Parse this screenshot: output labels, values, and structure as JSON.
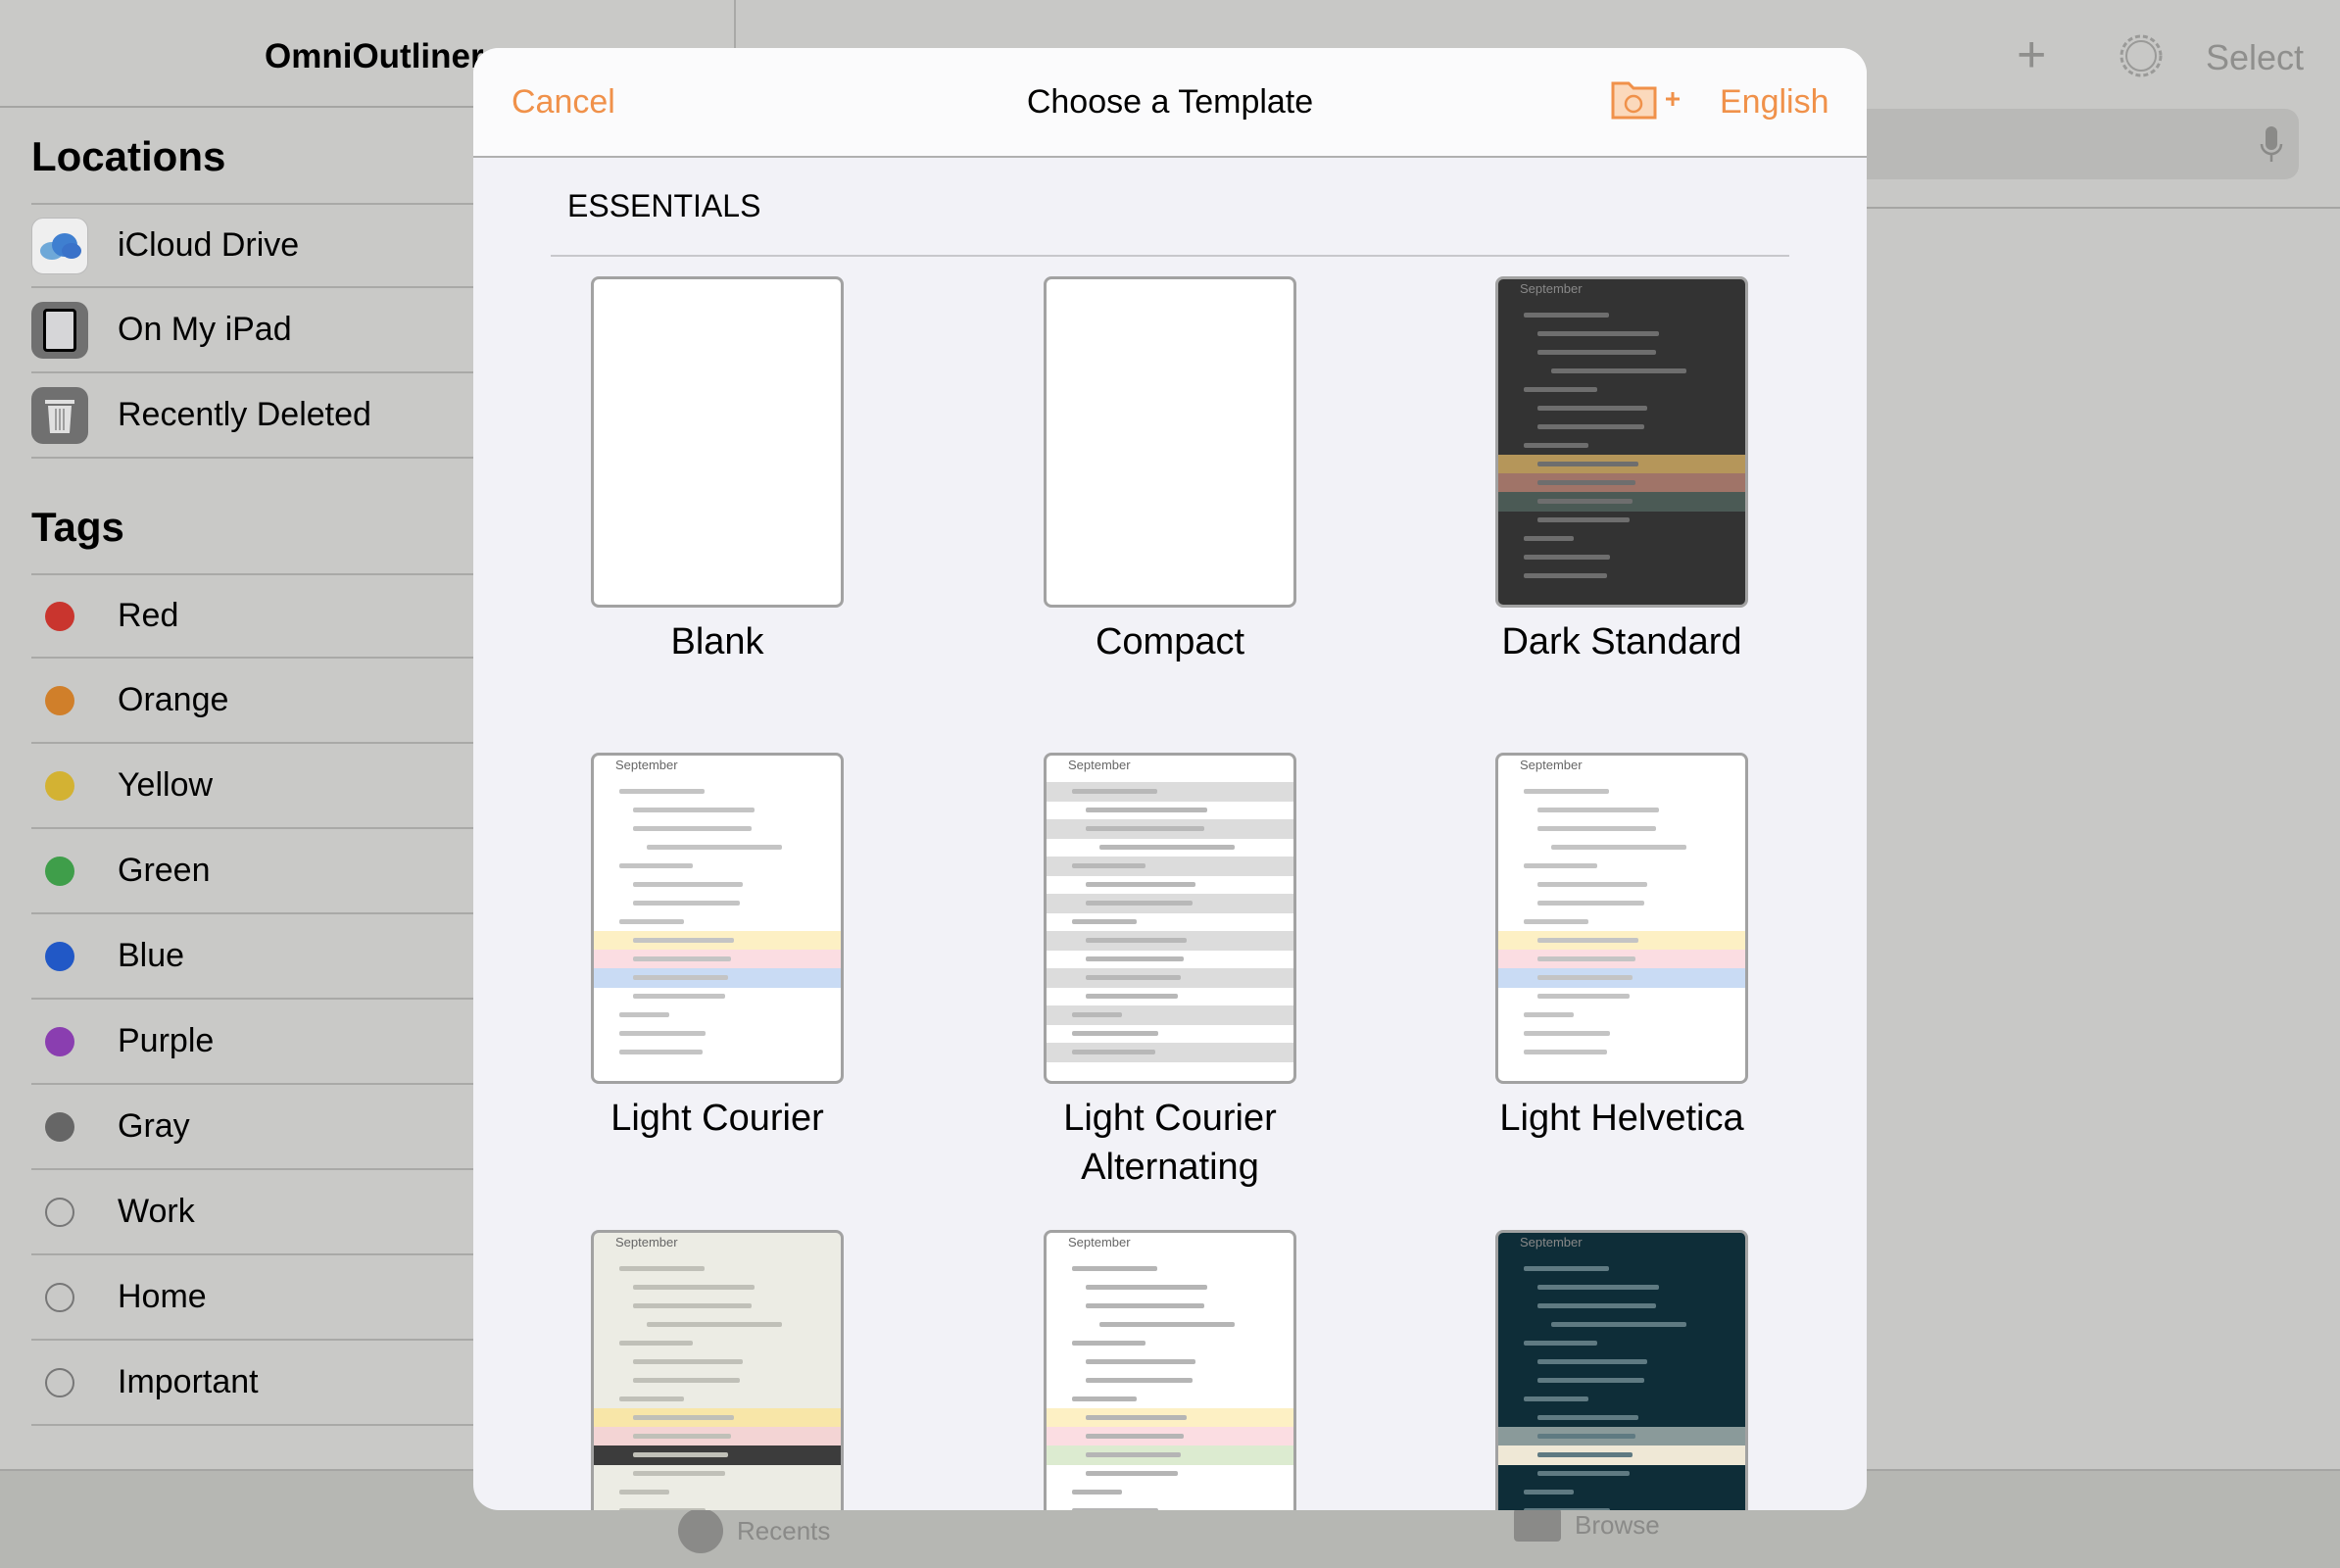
{
  "app": {
    "title": "OmniOutliner"
  },
  "sidebar": {
    "locations_heading": "Locations",
    "locations": [
      {
        "label": "iCloud Drive",
        "icon": "icloud-icon"
      },
      {
        "label": "On My iPad",
        "icon": "ipad-icon"
      },
      {
        "label": "Recently Deleted",
        "icon": "trash-icon"
      }
    ],
    "tags_heading": "Tags",
    "tags": [
      {
        "label": "Red",
        "color": "#c9352e"
      },
      {
        "label": "Orange",
        "color": "#d07f2a"
      },
      {
        "label": "Yellow",
        "color": "#d3b233"
      },
      {
        "label": "Green",
        "color": "#3f9e4a"
      },
      {
        "label": "Blue",
        "color": "#2158c6"
      },
      {
        "label": "Purple",
        "color": "#8a3eb0"
      },
      {
        "label": "Gray",
        "color": "#666666"
      },
      {
        "label": "Work",
        "color": ""
      },
      {
        "label": "Home",
        "color": ""
      },
      {
        "label": "Important",
        "color": ""
      }
    ]
  },
  "toolbar": {
    "select_label": "Select",
    "add_icon": "plus-icon",
    "settings_icon": "gear-icon",
    "mic_icon": "microphone-icon"
  },
  "tabbar": {
    "recents": "Recents",
    "browse": "Browse"
  },
  "modal": {
    "cancel": "Cancel",
    "title": "Choose a Template",
    "language": "English",
    "add_folder_icon": "folder-add-icon",
    "section": "ESSENTIALS",
    "templates": [
      {
        "name": "Blank",
        "style": "blank",
        "bg": "#ffffff"
      },
      {
        "name": "Compact",
        "style": "blank",
        "bg": "#ffffff"
      },
      {
        "name": "Dark Standard",
        "style": "outline",
        "bg": "#333333",
        "line": "#6e6e6e",
        "hl": {
          "9": "#b5965a",
          "10": "#a07468",
          "11": "#4b5a55"
        }
      },
      {
        "name": "Light Courier",
        "style": "outline",
        "bg": "#ffffff",
        "line": "#c4c4c4",
        "hl": {
          "9": "#fdf0c4",
          "10": "#fbdde2",
          "11": "#c9dbf4"
        }
      },
      {
        "name": "Light Courier Alternating",
        "style": "alternating",
        "bg": "#ffffff",
        "line": "#b8b8b8"
      },
      {
        "name": "Light Helvetica",
        "style": "outline",
        "bg": "#ffffff",
        "line": "#c4c4c4",
        "hl": {
          "9": "#fdf0c4",
          "10": "#fbdde2",
          "11": "#c9dbf4"
        }
      },
      {
        "name": "",
        "style": "outline",
        "bg": "#ecece4",
        "line": "#c0c0b8",
        "hl": {
          "9": "#f8e6a8",
          "10": "#f3d4d4",
          "11": "#3c3c3c"
        }
      },
      {
        "name": "",
        "style": "outline",
        "bg": "#ffffff",
        "line": "#b5b5b5",
        "hl": {
          "9": "#fdf0c4",
          "10": "#fbdde2",
          "11": "#dcebd0"
        }
      },
      {
        "name": "",
        "style": "outline",
        "bg": "#0e2d38",
        "line": "#5f7a82",
        "hl": {
          "10": "#8a9a9a",
          "11": "#efe8d6"
        }
      }
    ],
    "thumb_title": "September"
  },
  "colors": {
    "accent": "#f0914a"
  }
}
